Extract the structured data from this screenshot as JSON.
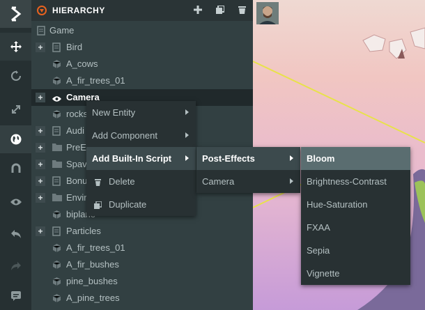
{
  "hierarchy": {
    "title": "HIERARCHY",
    "items": [
      {
        "label": "Game"
      },
      {
        "label": "Bird"
      },
      {
        "label": "A_cows"
      },
      {
        "label": "A_fir_trees_01"
      },
      {
        "label": "Camera"
      },
      {
        "label": "rocks"
      },
      {
        "label": "Audi"
      },
      {
        "label": "PreE"
      },
      {
        "label": "Spav"
      },
      {
        "label": "Bonu"
      },
      {
        "label": "Envir"
      },
      {
        "label": "biplane"
      },
      {
        "label": "Particles"
      },
      {
        "label": "A_fir_trees_01"
      },
      {
        "label": "A_fir_bushes"
      },
      {
        "label": "pine_bushes"
      },
      {
        "label": "A_pine_trees"
      }
    ]
  },
  "context_menu": {
    "items": [
      {
        "label": "New Entity"
      },
      {
        "label": "Add Component"
      },
      {
        "label": "Add Built-In Script"
      },
      {
        "label": "Delete"
      },
      {
        "label": "Duplicate"
      }
    ]
  },
  "script_submenu": {
    "items": [
      {
        "label": "Post-Effects"
      },
      {
        "label": "Camera"
      }
    ]
  },
  "effects_submenu": {
    "items": [
      {
        "label": "Bloom"
      },
      {
        "label": "Brightness-Contrast"
      },
      {
        "label": "Hue-Saturation"
      },
      {
        "label": "FXAA"
      },
      {
        "label": "Sepia"
      },
      {
        "label": "Vignette"
      }
    ]
  },
  "colors": {
    "accent": "#e8621f",
    "panel_bg": "#324042",
    "menu_bg": "#283133",
    "selected_bg": "#20292b"
  },
  "icons": [
    "logo-icon",
    "move-icon",
    "rotate-icon",
    "scale-icon",
    "world-icon",
    "magnet-icon",
    "eye-icon",
    "undo-icon",
    "redo-icon",
    "chat-icon",
    "plus-icon",
    "copy-icon",
    "trash-icon",
    "file-icon",
    "entity-icon",
    "folder-icon"
  ]
}
